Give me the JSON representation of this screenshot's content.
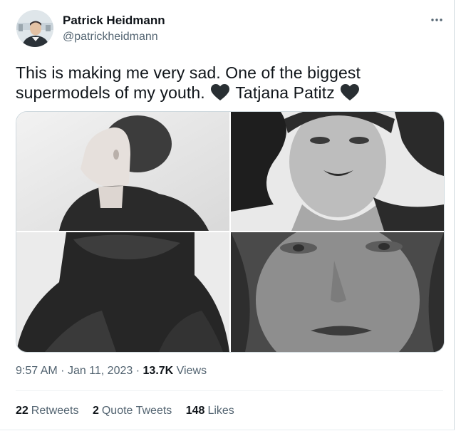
{
  "author": {
    "name": "Patrick Heidmann",
    "handle": "@patrickheidmann"
  },
  "tweet": {
    "line1": "This is making me very sad. One of the biggest",
    "line2_part1": "supermodels of my youth.",
    "line2_part2": "Tatjana Patitz",
    "emoji": "black-heart"
  },
  "media": {
    "photos": [
      {
        "description_icon": "photo"
      },
      {
        "description_icon": "photo"
      },
      {
        "description_icon": "photo"
      },
      {
        "description_icon": "photo"
      }
    ]
  },
  "meta": {
    "time": "9:57 AM",
    "separator": "·",
    "date": "Jan 11, 2023",
    "views_count": "13.7K",
    "views_label": "Views"
  },
  "stats": {
    "retweets_count": "22",
    "retweets_label": "Retweets",
    "quotes_count": "2",
    "quotes_label": "Quote Tweets",
    "likes_count": "148",
    "likes_label": "Likes"
  },
  "colors": {
    "text_primary": "#0f1419",
    "text_secondary": "#536471",
    "border": "#cfd9de"
  }
}
